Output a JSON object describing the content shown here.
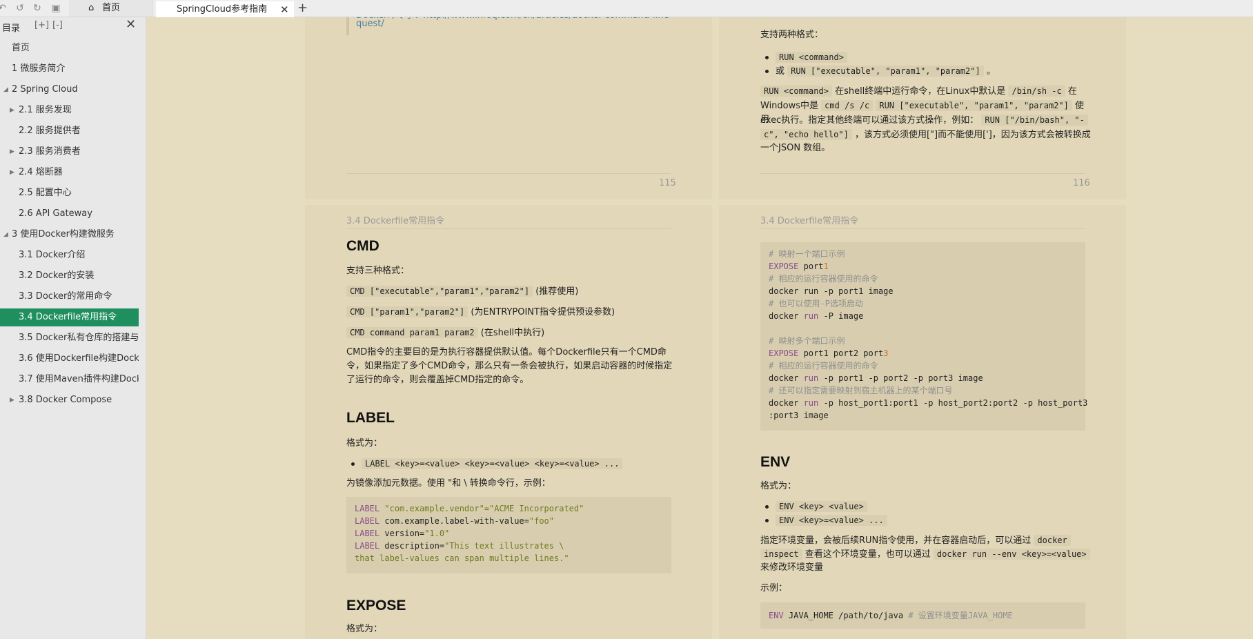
{
  "tabs": {
    "home_label": "首页",
    "active_label": "SpringCloud参考指南"
  },
  "sidebar": {
    "title": "目录",
    "items": [
      {
        "label": "首页"
      },
      {
        "label": "1 微服务简介"
      },
      {
        "label": "2 Spring Cloud"
      },
      {
        "label": "2.1 服务发现"
      },
      {
        "label": "2.2 服务提供者"
      },
      {
        "label": "2.3 服务消费者"
      },
      {
        "label": "2.4 熔断器"
      },
      {
        "label": "2.5 配置中心"
      },
      {
        "label": "2.6 API Gateway"
      },
      {
        "label": "3 使用Docker构建微服务"
      },
      {
        "label": "3.1 Docker介绍"
      },
      {
        "label": "3.2 Docker的安装"
      },
      {
        "label": "3.3 Docker的常用命令"
      },
      {
        "label": "3.4 Dockerfile常用指令"
      },
      {
        "label": "3.5 Docker私有仓库的搭建与..."
      },
      {
        "label": "3.6 使用Dockerfile构建Dock..."
      },
      {
        "label": "3.7 使用Maven插件构建Dock..."
      },
      {
        "label": "3.8 Docker Compose"
      }
    ]
  },
  "pages": {
    "p115": {
      "quote_line1": "Docker命令手：http://www.infoq.com/cn/articles/docker-command-line-",
      "quote_line2": "quest/",
      "number": "115"
    },
    "p116": {
      "intro": "支持两种格式：",
      "bullet1": "RUN <command>",
      "bullet2_prefix": "或",
      "bullet2_code": "RUN [\"executable\", \"param1\", \"param2\"]",
      "bullet2_suffix": "。",
      "para_l1_code1": "RUN <command>",
      "para_l1_text1": "在shell终端中运行命令，在Linux中默认是",
      "para_l1_code2": "/bin/sh -c",
      "para_l1_text2": "在",
      "para_l2_text1": "Windows中是",
      "para_l2_code1": "cmd /s /c",
      "para_l2_code2": "RUN [\"executable\", \"param1\", \"param2\"]",
      "para_l2_text2": "使用",
      "para_l3_text1": "exec执行。指定其他终端可以通过该方式操作，例如：",
      "para_l3_code1": "RUN [\"/bin/bash\", \"-",
      "para_l4_code1": "c\", \"echo hello\"]",
      "para_l4_text1": "，该方式必须使用[\"]而不能使用[']，因为该方式会被转换成",
      "para_l5_text1": "一个JSON 数组。",
      "number": "116"
    },
    "p117": {
      "runhead": "3.4 Dockerfile常用指令",
      "cmd_title": "CMD",
      "cmd_intro": "支持三种格式：",
      "cmd_f1_code": "CMD [\"executable\",\"param1\",\"param2\"]",
      "cmd_f1_text": "(推荐使用)",
      "cmd_f2_code": "CMD [\"param1\",\"param2\"]",
      "cmd_f2_text": "(为ENTRYPOINT指令提供预设参数)",
      "cmd_f3_code": "CMD command param1 param2",
      "cmd_f3_text": "(在shell中执行)",
      "cmd_desc_l1": "CMD指令的主要目的是为执行容器提供默认值。每个Dockerfile只有一个CMD命",
      "cmd_desc_l2": "令，如果指定了多个CMD命令，那么只有一条会被执行，如果启动容器的时候指定",
      "cmd_desc_l3": "了运行的命令，则会覆盖掉CMD指定的命令。",
      "label_title": "LABEL",
      "label_intro": "格式为：",
      "label_bullet": "LABEL <key>=<value> <key>=<value> <key>=<value> ...",
      "label_desc": "为镜像添加元数据。使用 \"和 \\ 转换命令行，示例：",
      "label_code": {
        "l1_kw": "LABEL",
        "l1_str": "\"com.example.vendor\"=\"ACME Incorporated\"",
        "l2_kw": "LABEL",
        "l2_txt": "com.example.label-with-value=",
        "l2_str": "\"foo\"",
        "l3_kw": "LABEL",
        "l3_txt": "version=",
        "l3_str": "\"1.0\"",
        "l4_kw": "LABEL",
        "l4_txt": "description=",
        "l4_str": "\"This text illustrates \\",
        "l5_str": "that label-values can span multiple lines.\""
      },
      "expose_title": "EXPOSE",
      "expose_intro": "格式为："
    },
    "p118": {
      "runhead": "3.4 Dockerfile常用指令",
      "code": {
        "c1": "# 映射一个端口示例",
        "l2_kw": "EXPOSE",
        "l2_txt": "port",
        "l2_num": "1",
        "c3": "# 相应的运行容器使用的命令",
        "l4_txt": "docker ",
        "l4_kw": "run",
        "l4_rest": " -p port1 image",
        "c5": "# 也可以使用-P选项启动",
        "l6_txt": "docker ",
        "l6_kw": "run",
        "l6_rest": " -P image",
        "c8": "# 映射多个端口示例",
        "l9_kw": "EXPOSE",
        "l9_txt": " port1 port2 port",
        "l9_num": "3",
        "c10": "# 相应的运行容器使用的命令",
        "l11_txt": "docker ",
        "l11_kw": "run",
        "l11_rest": " -p port1 -p port2 -p port3 image",
        "c12": "# 还可以指定需要映射到宿主机器上的某个端口号",
        "l13_txt": "docker ",
        "l13_kw": "run",
        "l13_rest": " -p host_port1:port1 -p host_port2:port2 -p host_port3",
        "l14_txt": ":port3 image"
      },
      "env_title": "ENV",
      "env_intro": "格式为：",
      "env_b1": "ENV <key> <value>",
      "env_b2": "ENV <key>=<value> ...",
      "env_desc_l1_text": "指定环境变量，会被后续RUN指令使用，并在容器启动后，可以通过",
      "env_desc_l1_code": "docker",
      "env_desc_l2_code1": "inspect",
      "env_desc_l2_text": "查看这个环境变量，也可以通过",
      "env_desc_l2_code2": "docker run --env <key>=<value>",
      "env_desc_l3_text": "来修改环境变量",
      "env_example": "示例：",
      "env_code_kw": "ENV",
      "env_code_txt": " JAVA_HOME /path/to/java ",
      "env_code_cm": "# 设置环境变量JAVA_HOME"
    }
  }
}
